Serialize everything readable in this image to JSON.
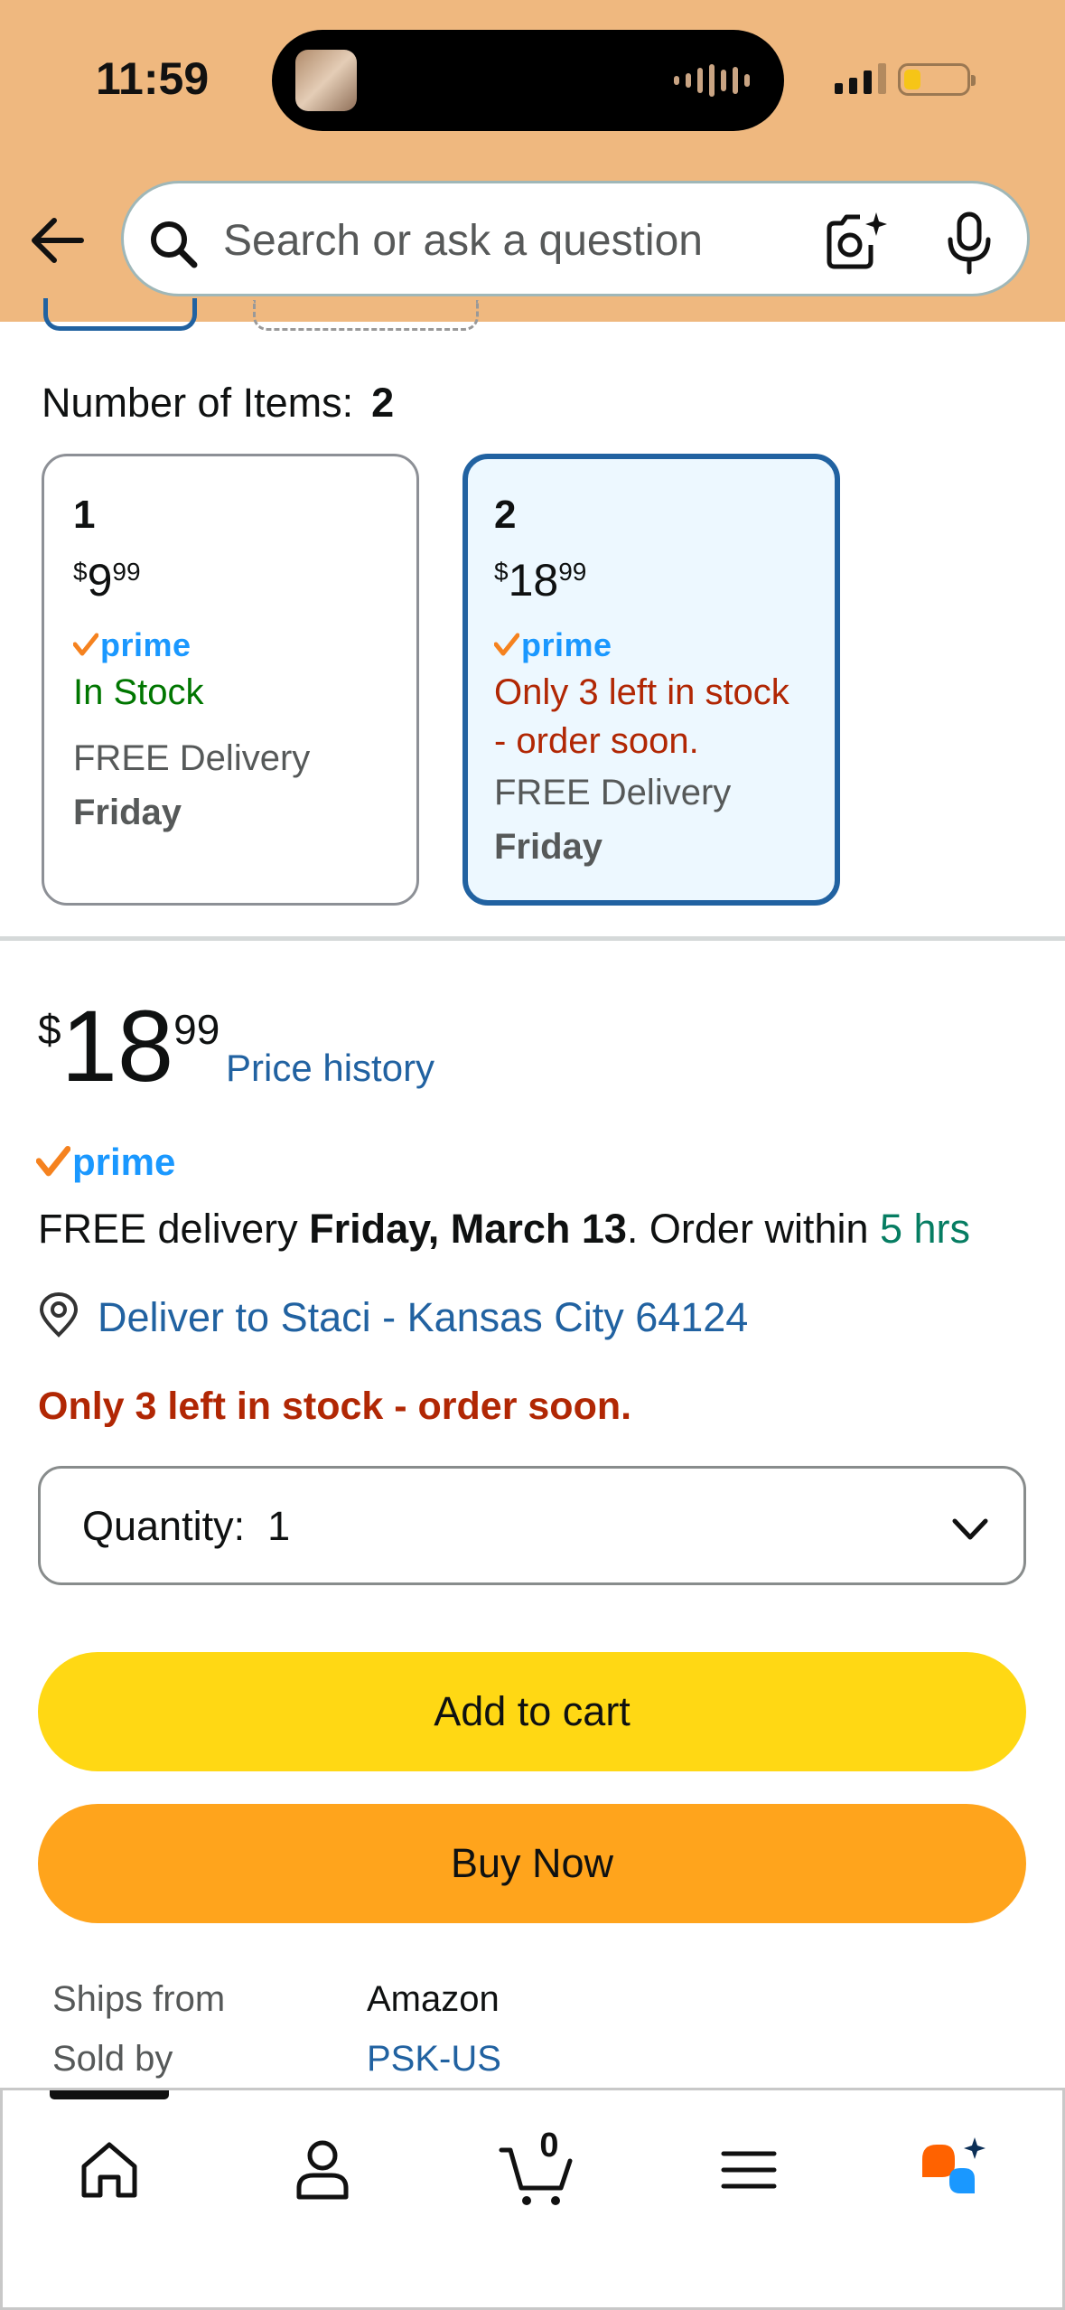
{
  "status_bar": {
    "time": "11:59"
  },
  "search": {
    "placeholder": "Search or ask a question"
  },
  "number_of_items": {
    "label": "Number of Items:",
    "selected": "2",
    "options": [
      {
        "count": "1",
        "price_currency": "$",
        "price_whole": "9",
        "price_cents": "99",
        "prime": "prime",
        "stock": "In Stock",
        "delivery": "FREE Delivery",
        "delivery_day": "Friday"
      },
      {
        "count": "2",
        "price_currency": "$",
        "price_whole": "18",
        "price_cents": "99",
        "prime": "prime",
        "stock_line1": "Only 3 left in stock",
        "stock_line2": "- order soon.",
        "delivery": "FREE Delivery",
        "delivery_day": "Friday"
      }
    ]
  },
  "price": {
    "currency": "$",
    "whole": "18",
    "cents": "99",
    "history_link": "Price history"
  },
  "prime_label": "prime",
  "delivery": {
    "prefix": "FREE delivery ",
    "date": "Friday, March 13",
    "middle": ". Order within ",
    "time_left": "5 hrs"
  },
  "deliver_to": "Deliver to Staci - Kansas City 64124",
  "stock_warning": "Only 3 left in stock - order soon.",
  "quantity": {
    "label": "Quantity:",
    "value": "1"
  },
  "buttons": {
    "add_to_cart": "Add to cart",
    "buy_now": "Buy Now"
  },
  "seller": {
    "ships_from_label": "Ships from",
    "ships_from_value": "Amazon",
    "sold_by_label": "Sold by",
    "sold_by_value": "PSK-US"
  },
  "tabbar": {
    "cart_count": "0"
  },
  "colors": {
    "header_bg": "#efb87f",
    "link_blue": "#2162a1",
    "prime_blue": "#1a98ff",
    "alert_red": "#b12704",
    "stock_green": "#007600",
    "add_to_cart": "#ffd814",
    "buy_now": "#ffa41c"
  }
}
